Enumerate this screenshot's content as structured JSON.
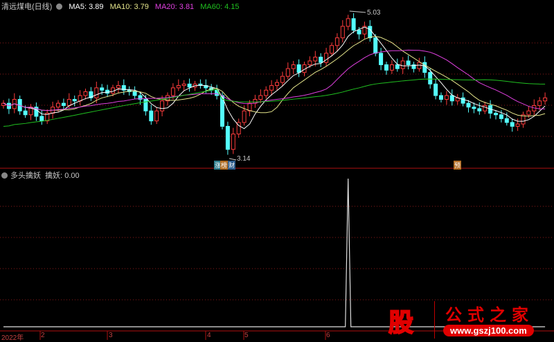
{
  "header": {
    "title": "清远煤电(日线)",
    "ma5": "MA5: 3.89",
    "ma10": "MA10: 3.79",
    "ma20": "MA20: 3.81",
    "ma60": "MA60: 4.15"
  },
  "indicator": {
    "title": "多头擒妖",
    "value": "擒妖: 0.00"
  },
  "annotations": {
    "high": "5.03",
    "low": "3.14",
    "tag1": "涨",
    "tag2": "榜",
    "tag3": "财",
    "tag4": "预"
  },
  "xaxis": [
    "2022年",
    "2",
    "3",
    "4",
    "5",
    "6"
  ],
  "watermark": {
    "logo_char": "股",
    "name": "公式之家",
    "url": "www.gszj100.com"
  },
  "colors": {
    "up": "#ff3c3c",
    "down": "#54ffff",
    "ma5": "#ffffff",
    "ma10": "#e6e68c",
    "ma20": "#e040e0",
    "ma60": "#20c020",
    "grid": "#8b1a1a"
  },
  "chart_data": {
    "type": "candlestick",
    "price_range": [
      3.14,
      5.03
    ],
    "closes": [
      3.85,
      3.78,
      3.9,
      3.75,
      3.7,
      3.8,
      3.68,
      3.62,
      3.72,
      3.8,
      3.85,
      3.82,
      3.9,
      3.88,
      3.95,
      4.0,
      3.92,
      4.05,
      4.02,
      3.98,
      4.05,
      4.08,
      4.02,
      4.0,
      3.95,
      3.9,
      3.75,
      3.62,
      3.75,
      3.88,
      3.95,
      4.05,
      4.08,
      4.1,
      4.06,
      4.1,
      4.08,
      4.05,
      4.02,
      3.95,
      3.55,
      3.25,
      3.45,
      3.6,
      3.75,
      3.85,
      3.9,
      3.95,
      4.02,
      4.08,
      4.12,
      4.2,
      4.3,
      4.35,
      4.25,
      4.35,
      4.4,
      4.45,
      4.38,
      4.5,
      4.6,
      4.7,
      4.85,
      4.95,
      4.8,
      4.75,
      4.85,
      4.7,
      4.5,
      4.35,
      4.28,
      4.35,
      4.3,
      4.4,
      4.35,
      4.3,
      4.38,
      4.25,
      4.1,
      3.95,
      3.9,
      3.95,
      3.88,
      3.92,
      3.85,
      3.8,
      3.78,
      3.75,
      3.82,
      3.72,
      3.7,
      3.65,
      3.6,
      3.55,
      3.58,
      3.7,
      3.75,
      3.82,
      3.88,
      3.92
    ],
    "signal": {
      "index": 63,
      "value": 1
    }
  }
}
